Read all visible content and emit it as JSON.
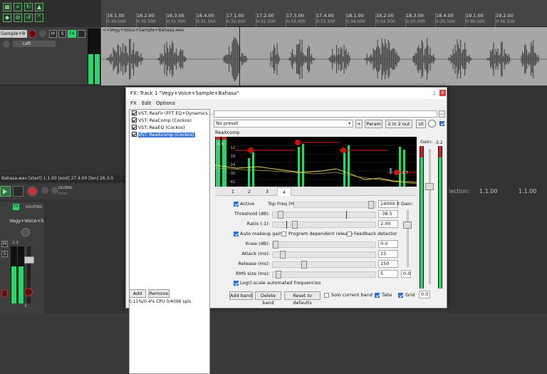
{
  "ruler": {
    "marks": [
      {
        "top": "16.1.00",
        "bottom": "0:30.000"
      },
      {
        "top": "16.2.00",
        "bottom": "0:30.500"
      },
      {
        "top": "16.3.00",
        "bottom": "0:31.000"
      },
      {
        "top": "16.4.00",
        "bottom": "0:31.500"
      },
      {
        "top": "17.1.00",
        "bottom": "0:32.000"
      },
      {
        "top": "17.2.00",
        "bottom": "0:32.500"
      },
      {
        "top": "17.3.00",
        "bottom": "0:33.000"
      },
      {
        "top": "17.4.00",
        "bottom": "0:33.500"
      },
      {
        "top": "18.1.00",
        "bottom": "0:34.000"
      },
      {
        "top": "18.2.00",
        "bottom": "0:34.500"
      },
      {
        "top": "18.3.00",
        "bottom": "0:35.000"
      },
      {
        "top": "18.4.00",
        "bottom": "0:35.500"
      },
      {
        "top": "19.1.00",
        "bottom": "0:36.000"
      },
      {
        "top": "19.2.00",
        "bottom": "0:36.500"
      }
    ]
  },
  "track": {
    "name": "Sample+B",
    "fx": "FX",
    "mute": "M",
    "solo": "S",
    "arm": "●",
    "route": "Left",
    "item_label": "<<Vegy+Voice+Sample+Bahasa.wav"
  },
  "lower": {
    "info": "Bahasa.wav [start] 1.1.00 [end] 27.4.00 [len] 26.3.0",
    "selection_label": "lection:",
    "sel_start": "1.1.00",
    "sel_end": "1.1.00",
    "global": "GLOBAL",
    "none": "none",
    "mixer_fx": "FX",
    "routing": "ROUTING",
    "mixer_track": "Vegy+Voice+Sa",
    "meter_peak": "-1.3",
    "m": "M",
    "s": "S",
    "num": "1"
  },
  "fx_window": {
    "title": "FX: Track 1 \"Vegy+Voice+Sample+Bahasa\"",
    "menu": [
      "FX",
      "Edit",
      "Options"
    ],
    "plugins": [
      {
        "label": "VST: ReaFir (FFT EQ+Dynamics ..."
      },
      {
        "label": "VST: ReaComp (Cockos)"
      },
      {
        "label": "VST: ReaEQ (Cockos)"
      },
      {
        "label": "VST: ReaXcomp (Cockos)"
      }
    ],
    "add": "Add",
    "remove": "Remove",
    "cpu": "0.11%/0.4% CPU 0/4096 spls",
    "preset": "No preset",
    "plus": "+",
    "param": "Param",
    "io": "2 in 2 out",
    "ui": "UI",
    "plugin_name": "ReaXcomp",
    "gain_label": "Gain:",
    "in_meter_top": "-5.5",
    "out_meter_top": "-3.2",
    "graph_labels": [
      "-12",
      "-18",
      "-24",
      "-30",
      "-42"
    ],
    "db_marker": "-2.7",
    "tabs": [
      "1",
      "2",
      "3",
      "4"
    ],
    "active_tab": "4",
    "active": "Active",
    "top_freq_label": "Top Freq (Hz):",
    "top_freq": "24000.0",
    "threshold_label": "Threshold (dB):",
    "threshold": "-38.5",
    "ratio_label": "Ratio (:1):",
    "ratio": "2.00",
    "auto_makeup": "Auto makeup gain",
    "program_release": "Program dependent release",
    "feedback": "Feedback detector",
    "knee_label": "Knee (dB):",
    "knee": "0.0",
    "attack_label": "Attack (ms):",
    "attack": "15",
    "release_label": "Release (ms):",
    "release": "150",
    "rms_label": "RMS size (ms):",
    "rms": "5",
    "band_gain_label": "Gain:",
    "band_gain": "0.0",
    "logscale": "Log()-scale automated frequencies",
    "add_band": "Add band",
    "delete_band": "Delete band",
    "reset": "Reset to defaults",
    "solo_band": "Solo current band",
    "tabs_label": "Tabs",
    "grid_label": "Grid",
    "out_gain": "0.0"
  },
  "colors": {
    "accent": "#2fd36b",
    "selection": "#3a78d8",
    "band_marker": "#cc1111"
  }
}
